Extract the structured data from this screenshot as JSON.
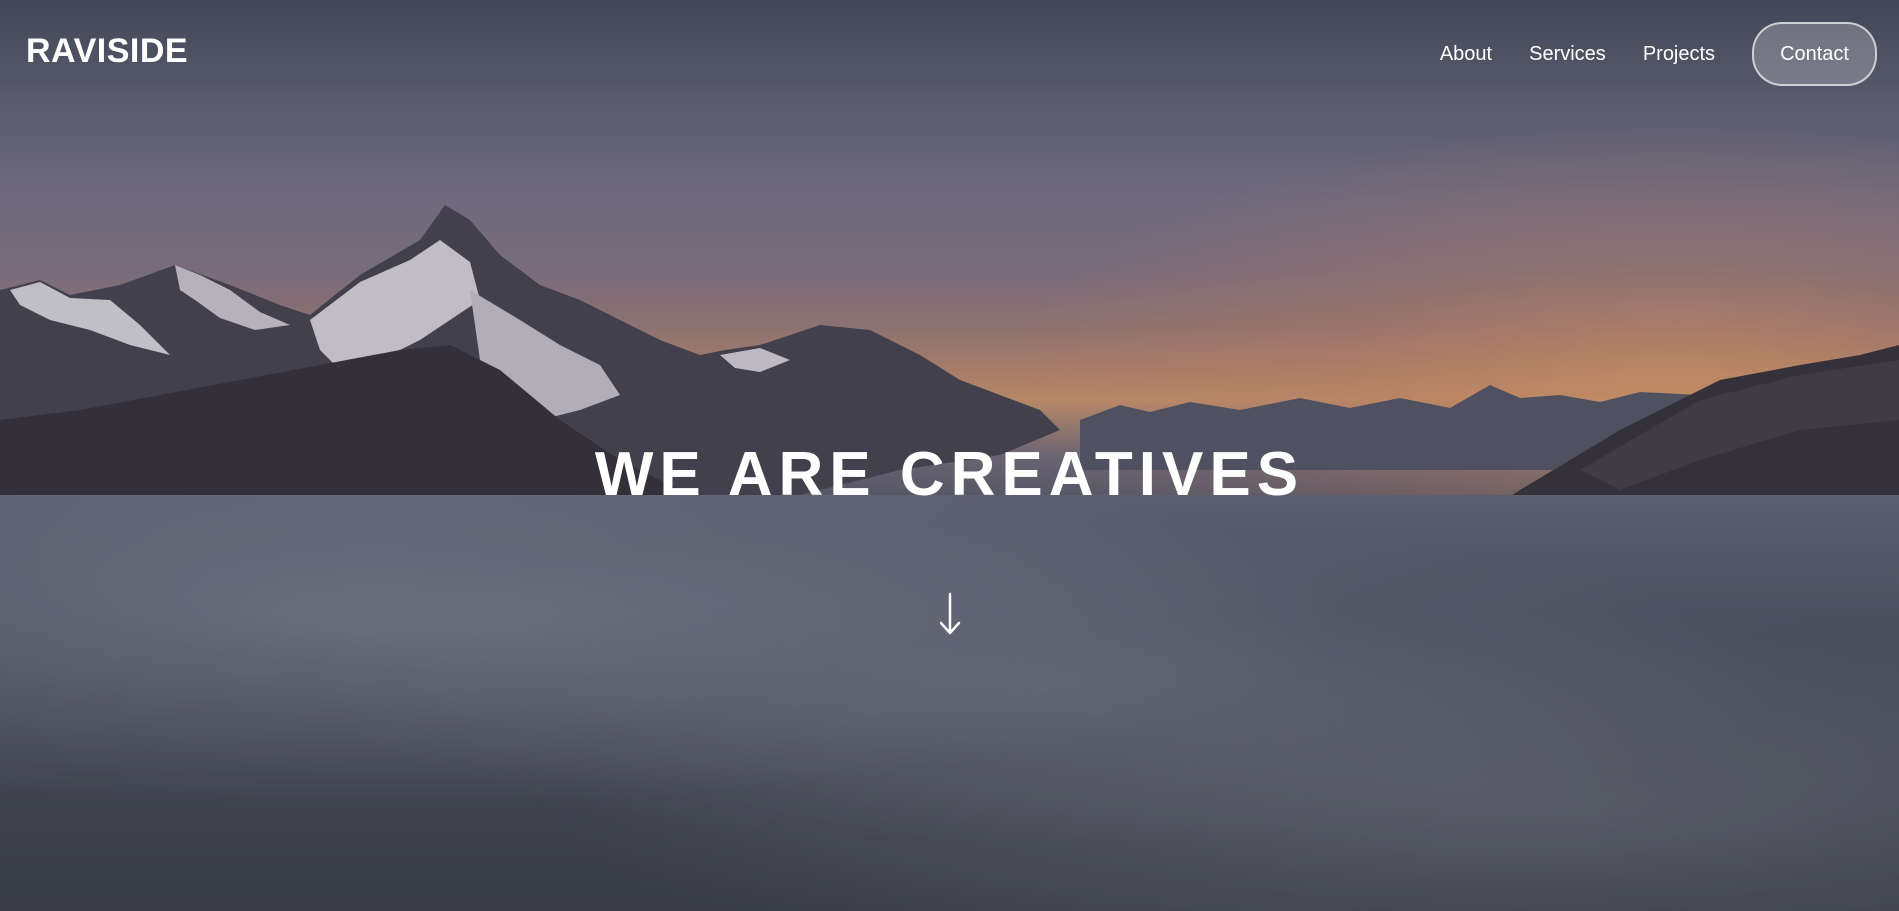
{
  "nav": {
    "logo": "RAVISIDE",
    "links": [
      {
        "label": "About"
      },
      {
        "label": "Services"
      },
      {
        "label": "Projects"
      }
    ],
    "contact_label": "Contact"
  },
  "hero": {
    "headline": "WE ARE CREATIVES",
    "scroll_icon": "arrow-down-icon",
    "background": "mountain-sunset-sea-of-clouds"
  }
}
